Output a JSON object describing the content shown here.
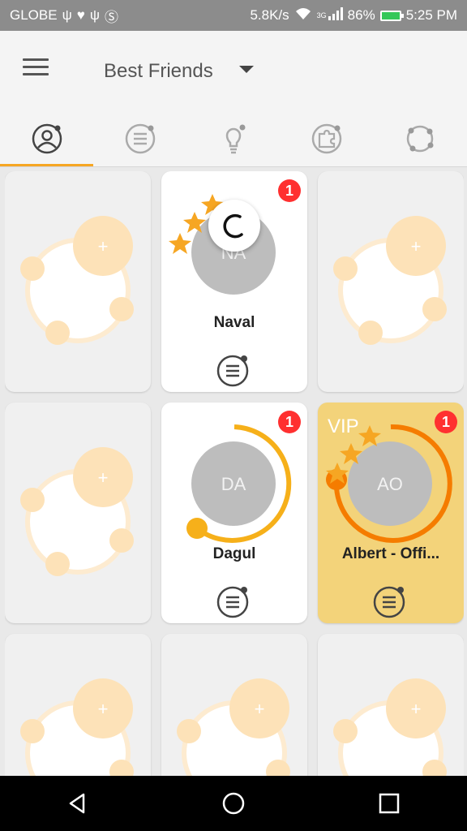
{
  "status_bar": {
    "carrier": "GLOBE",
    "net_speed": "5.8K/s",
    "network_type": "3G",
    "battery": "86%",
    "time": "5:25 PM",
    "icons": [
      "usb-icon",
      "health-icon",
      "usb-icon",
      "skype-icon",
      "wifi-icon",
      "signal-icon",
      "battery-icon"
    ]
  },
  "app_bar": {
    "title": "Best Friends",
    "menu_icon": "hamburger-menu-icon",
    "dropdown_icon": "caret-down-icon"
  },
  "tabs": [
    {
      "icon": "person-icon",
      "active": true
    },
    {
      "icon": "list-icon",
      "active": false
    },
    {
      "icon": "lightbulb-icon",
      "active": false
    },
    {
      "icon": "puzzle-icon",
      "active": false
    },
    {
      "icon": "network-icon",
      "active": false
    }
  ],
  "cards": [
    {
      "type": "empty",
      "add_label": "+"
    },
    {
      "type": "friend",
      "initials": "NA",
      "name": "Naval",
      "badge": "1"
    },
    {
      "type": "empty",
      "add_label": "+"
    },
    {
      "type": "empty",
      "add_label": "+"
    },
    {
      "type": "friend",
      "initials": "DA",
      "name": "Dagul",
      "badge": "1"
    },
    {
      "type": "vip",
      "vip_label": "VIP",
      "initials": "AO",
      "name": "Albert - Offi...",
      "badge": "1"
    },
    {
      "type": "empty",
      "add_label": "+"
    },
    {
      "type": "empty",
      "add_label": "+"
    },
    {
      "type": "empty",
      "add_label": "+"
    }
  ],
  "colors": {
    "accent": "#f6a623",
    "badge": "#ff3030",
    "vip_card": "#f3d37a",
    "ring_yellow": "#f6b01a",
    "ring_orange": "#f57c00",
    "empty_bubble": "#fde2b8",
    "avatar_gray": "#bdbdbd"
  },
  "nav_bar": {
    "icons": [
      "back-icon",
      "home-icon",
      "recents-icon"
    ]
  }
}
